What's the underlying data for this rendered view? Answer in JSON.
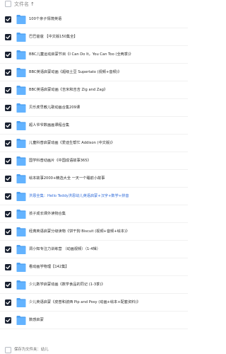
{
  "header": {
    "column_label": "文件名",
    "sort_indicator": "↑"
  },
  "colors": {
    "checkbox_fill": "#1b2333",
    "folder_back": "#4ea0f1",
    "folder_front": "#63b3ff",
    "text": "#2b2b2b",
    "link_text": "#2f6bd9"
  },
  "icons": {
    "row": "folder-icon",
    "check": "checkmark-icon"
  },
  "files": [
    {
      "name": "100个亲子情境英语",
      "checked": true,
      "blue": false
    },
    {
      "name": "巴巴爸爸 【中文版150集全】",
      "checked": true,
      "blue": false
    },
    {
      "name": "BBC儿童运动启蒙节目《I Can Do It，You Can Too (全两季)》",
      "checked": true,
      "blue": false
    },
    {
      "name": "BBC英语启蒙动画《超级土豆 Supertato (视频+音频)》",
      "checked": true,
      "blue": false
    },
    {
      "name": "BBC英语启蒙动画《吉米和吉吉 Zig and Zag》",
      "checked": true,
      "blue": false
    },
    {
      "name": "贝乐虎早教儿歌动画合集209课",
      "checked": true,
      "blue": false
    },
    {
      "name": "超人爷爷数画画课程合集",
      "checked": true,
      "blue": false
    },
    {
      "name": "儿童科普启蒙动画《爱迪生帮忙 Addison (中文版)》",
      "checked": true,
      "blue": false
    },
    {
      "name": "国学科普动画片《中国成语故事365》",
      "checked": true,
      "blue": false
    },
    {
      "name": "绘本故事2000+精选大全 一天一个睡前小故事",
      "checked": true,
      "blue": false
    },
    {
      "name": "洪恩全集：Hello Teddy洪恩幼儿英语启蒙+汉字+数学+拼音",
      "checked": true,
      "blue": true
    },
    {
      "name": "孩子成长课外读物合集",
      "checked": true,
      "blue": false
    },
    {
      "name": "经典英语启蒙分级读物《饼干狗 Biscuit (视频+音频+绘本)》",
      "checked": true,
      "blue": false
    },
    {
      "name": "洞小知专注力训练营 （动画视频）（1-4辑）",
      "checked": true,
      "blue": false
    },
    {
      "name": "看动画学物理【142集】",
      "checked": true,
      "blue": false
    },
    {
      "name": "少儿数学启蒙动画《数学食品的同记 (1-3季)》",
      "checked": true,
      "blue": false
    },
    {
      "name": "少儿英语启蒙《皮普和波西 Pip and Posy (动画+绘本+配套资料)》",
      "checked": true,
      "blue": false
    },
    {
      "name": "数感启蒙",
      "checked": true,
      "blue": false
    }
  ],
  "footer": {
    "save_label": "保存为文件夹：幼儿"
  }
}
